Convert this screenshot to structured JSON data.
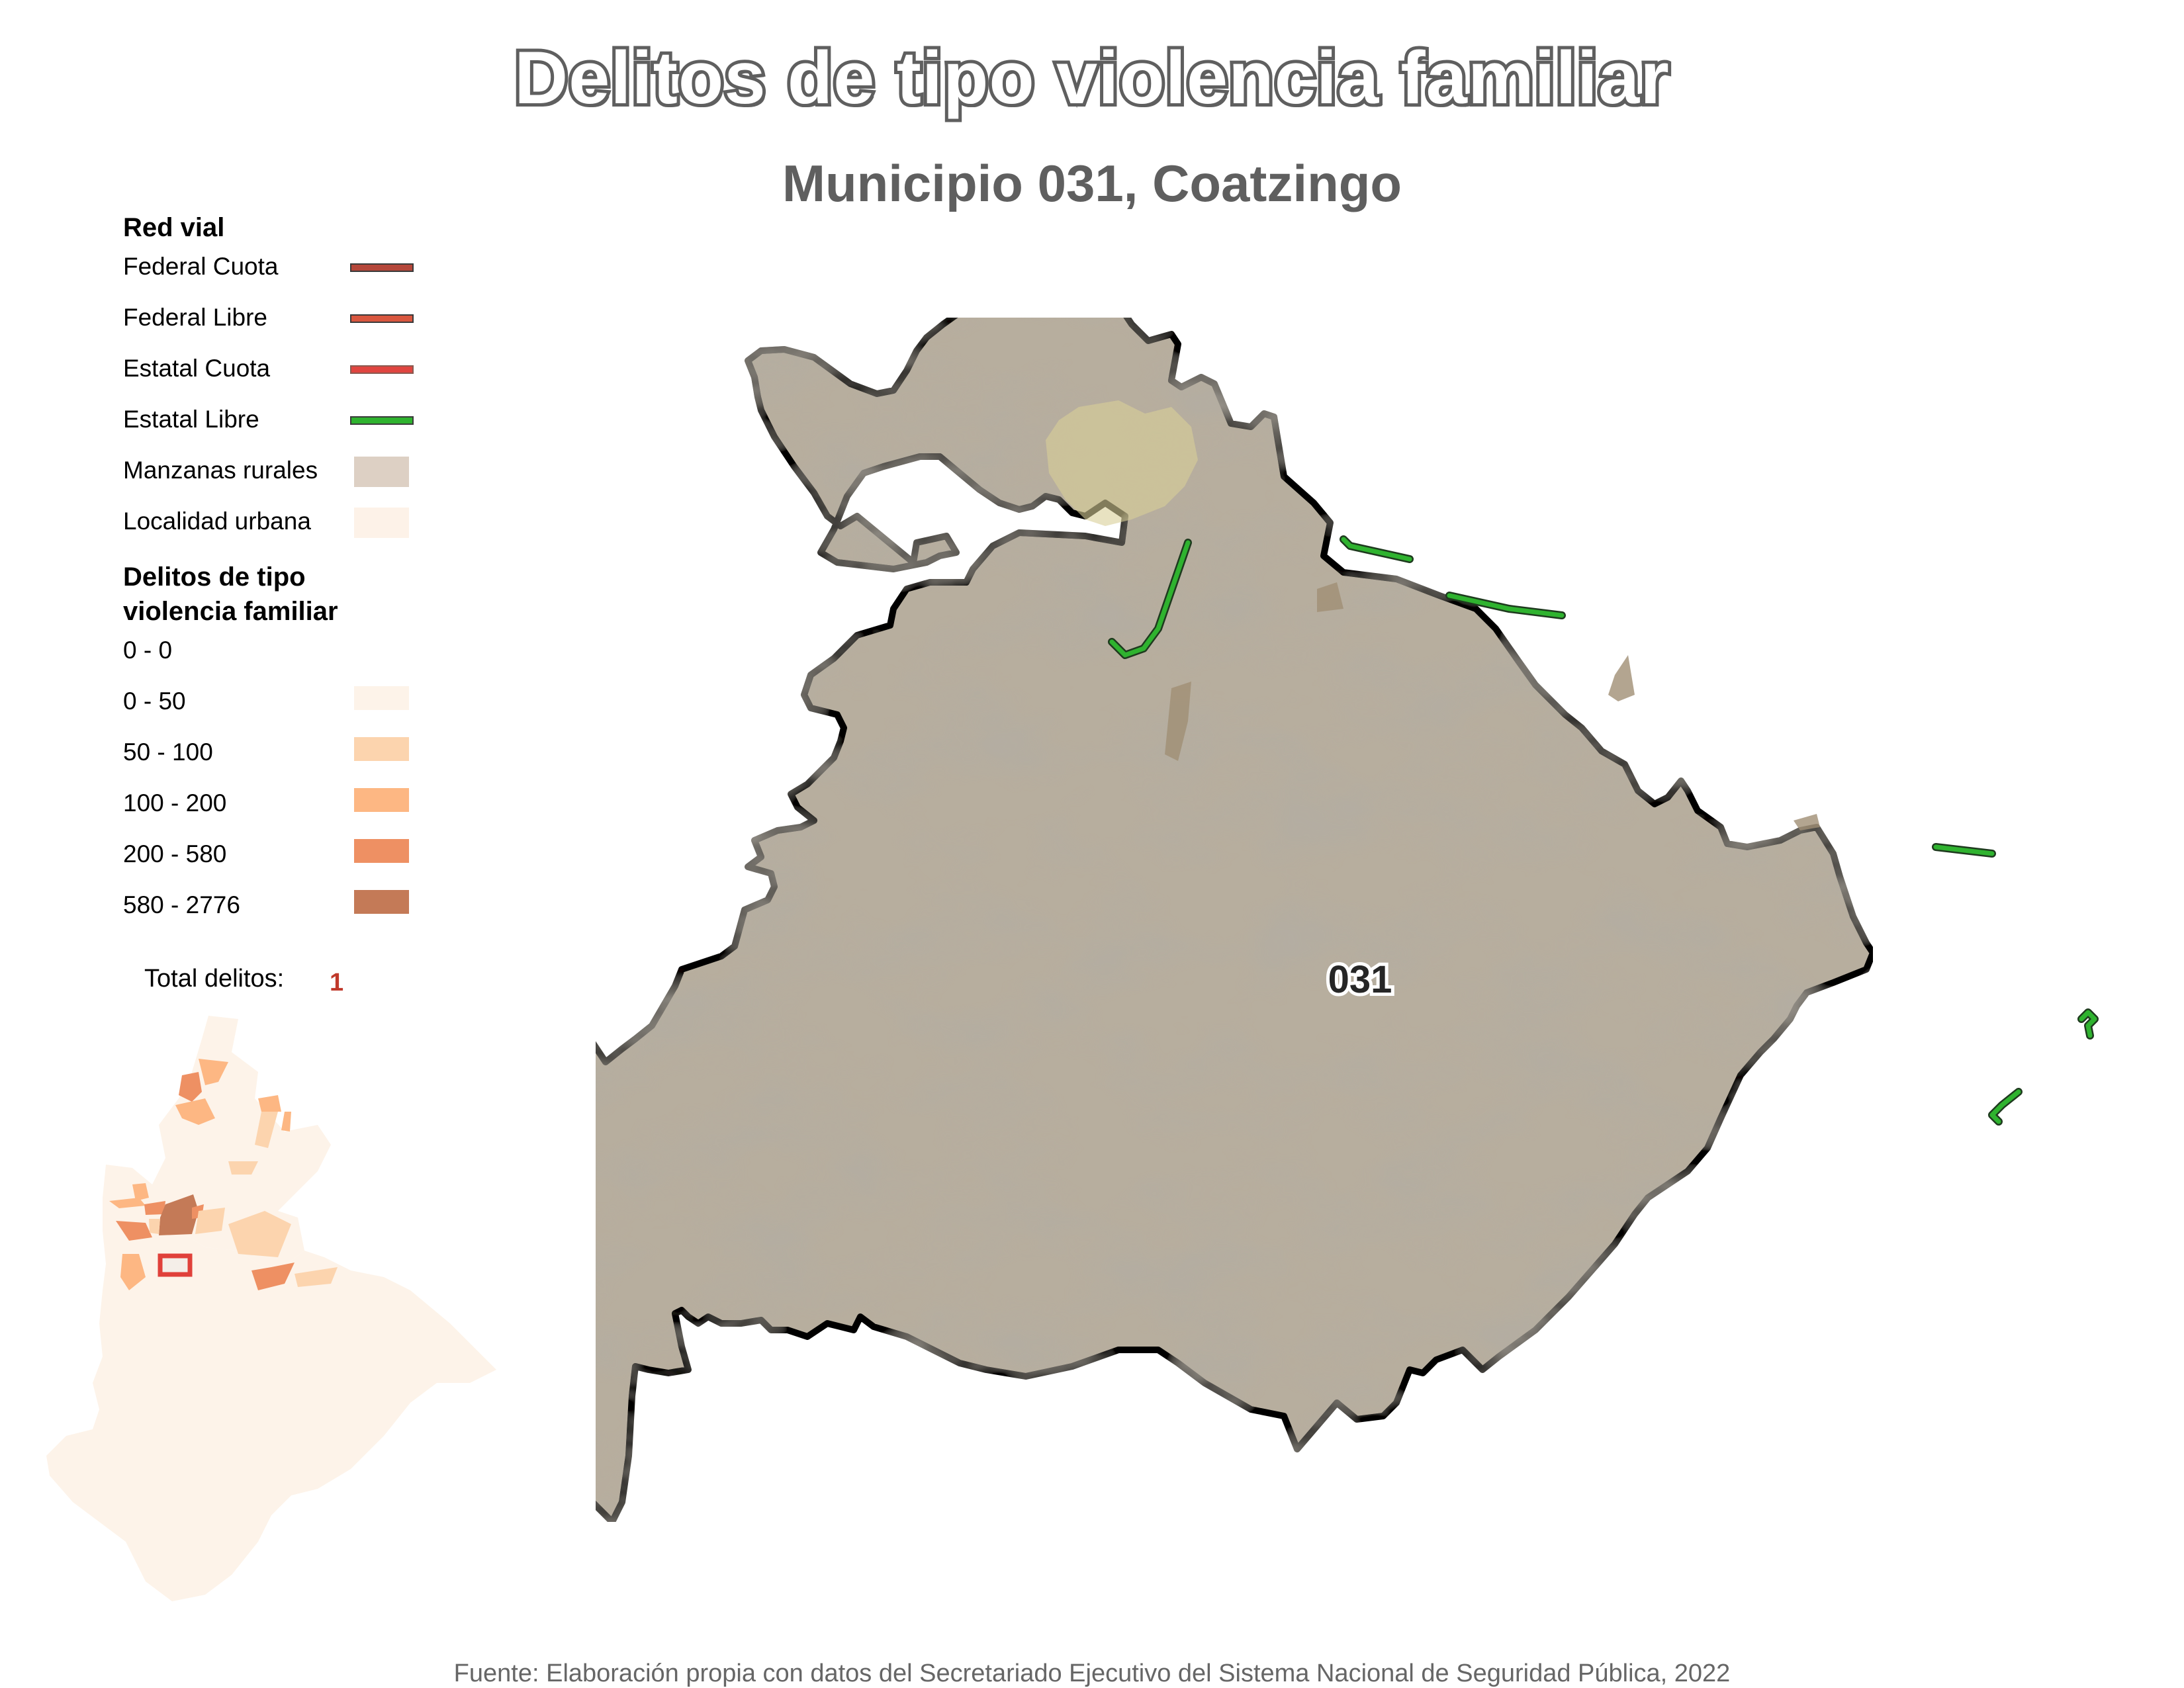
{
  "header": {
    "title": "Delitos de tipo violencia familiar",
    "subtitle": "Municipio 031, Coatzingo"
  },
  "legend": {
    "road_heading": "Red vial",
    "roads": [
      {
        "label": "Federal Cuota",
        "color": "#b5473a"
      },
      {
        "label": "Federal Libre",
        "color": "#d9573f"
      },
      {
        "label": "Estatal Cuota",
        "color": "#e04540"
      },
      {
        "label": "Estatal Libre",
        "color": "#2fb32f"
      }
    ],
    "areas": [
      {
        "label": "Manzanas rurales",
        "color": "#ddd0c4"
      },
      {
        "label": "Localidad urbana",
        "color": "#fdf2e8"
      }
    ],
    "crime_heading_line1": "Delitos de tipo",
    "crime_heading_line2": "violencia familiar",
    "classes": [
      {
        "label": "0 - 0",
        "color": null
      },
      {
        "label": "0 - 50",
        "color": "#fdf3e9"
      },
      {
        "label": "50 - 100",
        "color": "#fcd4ae"
      },
      {
        "label": "100 - 200",
        "color": "#fdb783"
      },
      {
        "label": "200 - 580",
        "color": "#ee9063"
      },
      {
        "label": "580 - 2776",
        "color": "#c47a57"
      }
    ],
    "total_label": "Total delitos:",
    "total_value": "1"
  },
  "map": {
    "municipality_label": "031",
    "terrain_color": "#b7ae9e",
    "urban_color": "#d8cf98",
    "boundary_color": "#000000",
    "highlight_color": "#e0403a"
  },
  "footer": {
    "source": "Fuente: Elaboración propia con datos del Secretariado Ejecutivo del Sistema Nacional de Seguridad Pública, 2022"
  }
}
